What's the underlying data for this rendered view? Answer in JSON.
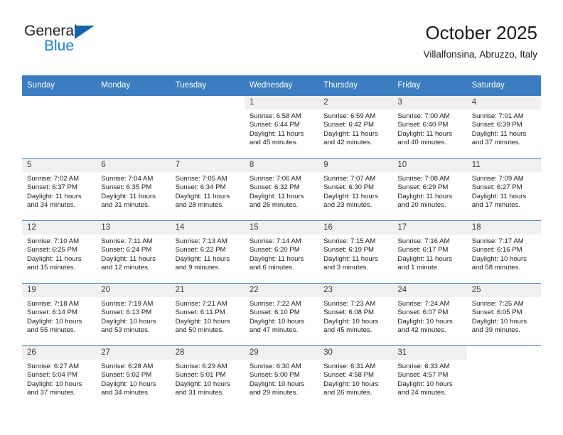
{
  "brand": {
    "name_top": "General",
    "name_bottom": "Blue",
    "accent_color": "#1880d4",
    "triangle_color": "#1464aa",
    "triangle_icon": "triangle-icon"
  },
  "header": {
    "title": "October 2025",
    "subtitle": "Villalfonsina, Abruzzo, Italy"
  },
  "theme": {
    "header_bar": "#3b7dc0",
    "daynum_bg": "#f0f0f0",
    "grid_line": "#3b7dc0",
    "text": "#1c1c1c"
  },
  "weekdays": [
    "Sunday",
    "Monday",
    "Tuesday",
    "Wednesday",
    "Thursday",
    "Friday",
    "Saturday"
  ],
  "weeks": [
    [
      {
        "day": "",
        "blank": true
      },
      {
        "day": "",
        "blank": true
      },
      {
        "day": "",
        "blank": true
      },
      {
        "day": "1",
        "sunrise": "Sunrise: 6:58 AM",
        "sunset": "Sunset: 6:44 PM",
        "daylight1": "Daylight: 11 hours",
        "daylight2": "and 45 minutes."
      },
      {
        "day": "2",
        "sunrise": "Sunrise: 6:59 AM",
        "sunset": "Sunset: 6:42 PM",
        "daylight1": "Daylight: 11 hours",
        "daylight2": "and 42 minutes."
      },
      {
        "day": "3",
        "sunrise": "Sunrise: 7:00 AM",
        "sunset": "Sunset: 6:40 PM",
        "daylight1": "Daylight: 11 hours",
        "daylight2": "and 40 minutes."
      },
      {
        "day": "4",
        "sunrise": "Sunrise: 7:01 AM",
        "sunset": "Sunset: 6:39 PM",
        "daylight1": "Daylight: 11 hours",
        "daylight2": "and 37 minutes."
      }
    ],
    [
      {
        "day": "5",
        "sunrise": "Sunrise: 7:02 AM",
        "sunset": "Sunset: 6:37 PM",
        "daylight1": "Daylight: 11 hours",
        "daylight2": "and 34 minutes."
      },
      {
        "day": "6",
        "sunrise": "Sunrise: 7:04 AM",
        "sunset": "Sunset: 6:35 PM",
        "daylight1": "Daylight: 11 hours",
        "daylight2": "and 31 minutes."
      },
      {
        "day": "7",
        "sunrise": "Sunrise: 7:05 AM",
        "sunset": "Sunset: 6:34 PM",
        "daylight1": "Daylight: 11 hours",
        "daylight2": "and 28 minutes."
      },
      {
        "day": "8",
        "sunrise": "Sunrise: 7:06 AM",
        "sunset": "Sunset: 6:32 PM",
        "daylight1": "Daylight: 11 hours",
        "daylight2": "and 26 minutes."
      },
      {
        "day": "9",
        "sunrise": "Sunrise: 7:07 AM",
        "sunset": "Sunset: 6:30 PM",
        "daylight1": "Daylight: 11 hours",
        "daylight2": "and 23 minutes."
      },
      {
        "day": "10",
        "sunrise": "Sunrise: 7:08 AM",
        "sunset": "Sunset: 6:29 PM",
        "daylight1": "Daylight: 11 hours",
        "daylight2": "and 20 minutes."
      },
      {
        "day": "11",
        "sunrise": "Sunrise: 7:09 AM",
        "sunset": "Sunset: 6:27 PM",
        "daylight1": "Daylight: 11 hours",
        "daylight2": "and 17 minutes."
      }
    ],
    [
      {
        "day": "12",
        "sunrise": "Sunrise: 7:10 AM",
        "sunset": "Sunset: 6:25 PM",
        "daylight1": "Daylight: 11 hours",
        "daylight2": "and 15 minutes."
      },
      {
        "day": "13",
        "sunrise": "Sunrise: 7:11 AM",
        "sunset": "Sunset: 6:24 PM",
        "daylight1": "Daylight: 11 hours",
        "daylight2": "and 12 minutes."
      },
      {
        "day": "14",
        "sunrise": "Sunrise: 7:13 AM",
        "sunset": "Sunset: 6:22 PM",
        "daylight1": "Daylight: 11 hours",
        "daylight2": "and 9 minutes."
      },
      {
        "day": "15",
        "sunrise": "Sunrise: 7:14 AM",
        "sunset": "Sunset: 6:20 PM",
        "daylight1": "Daylight: 11 hours",
        "daylight2": "and 6 minutes."
      },
      {
        "day": "16",
        "sunrise": "Sunrise: 7:15 AM",
        "sunset": "Sunset: 6:19 PM",
        "daylight1": "Daylight: 11 hours",
        "daylight2": "and 3 minutes."
      },
      {
        "day": "17",
        "sunrise": "Sunrise: 7:16 AM",
        "sunset": "Sunset: 6:17 PM",
        "daylight1": "Daylight: 11 hours",
        "daylight2": "and 1 minute."
      },
      {
        "day": "18",
        "sunrise": "Sunrise: 7:17 AM",
        "sunset": "Sunset: 6:16 PM",
        "daylight1": "Daylight: 10 hours",
        "daylight2": "and 58 minutes."
      }
    ],
    [
      {
        "day": "19",
        "sunrise": "Sunrise: 7:18 AM",
        "sunset": "Sunset: 6:14 PM",
        "daylight1": "Daylight: 10 hours",
        "daylight2": "and 55 minutes."
      },
      {
        "day": "20",
        "sunrise": "Sunrise: 7:19 AM",
        "sunset": "Sunset: 6:13 PM",
        "daylight1": "Daylight: 10 hours",
        "daylight2": "and 53 minutes."
      },
      {
        "day": "21",
        "sunrise": "Sunrise: 7:21 AM",
        "sunset": "Sunset: 6:11 PM",
        "daylight1": "Daylight: 10 hours",
        "daylight2": "and 50 minutes."
      },
      {
        "day": "22",
        "sunrise": "Sunrise: 7:22 AM",
        "sunset": "Sunset: 6:10 PM",
        "daylight1": "Daylight: 10 hours",
        "daylight2": "and 47 minutes."
      },
      {
        "day": "23",
        "sunrise": "Sunrise: 7:23 AM",
        "sunset": "Sunset: 6:08 PM",
        "daylight1": "Daylight: 10 hours",
        "daylight2": "and 45 minutes."
      },
      {
        "day": "24",
        "sunrise": "Sunrise: 7:24 AM",
        "sunset": "Sunset: 6:07 PM",
        "daylight1": "Daylight: 10 hours",
        "daylight2": "and 42 minutes."
      },
      {
        "day": "25",
        "sunrise": "Sunrise: 7:25 AM",
        "sunset": "Sunset: 6:05 PM",
        "daylight1": "Daylight: 10 hours",
        "daylight2": "and 39 minutes."
      }
    ],
    [
      {
        "day": "26",
        "sunrise": "Sunrise: 6:27 AM",
        "sunset": "Sunset: 5:04 PM",
        "daylight1": "Daylight: 10 hours",
        "daylight2": "and 37 minutes."
      },
      {
        "day": "27",
        "sunrise": "Sunrise: 6:28 AM",
        "sunset": "Sunset: 5:02 PM",
        "daylight1": "Daylight: 10 hours",
        "daylight2": "and 34 minutes."
      },
      {
        "day": "28",
        "sunrise": "Sunrise: 6:29 AM",
        "sunset": "Sunset: 5:01 PM",
        "daylight1": "Daylight: 10 hours",
        "daylight2": "and 31 minutes."
      },
      {
        "day": "29",
        "sunrise": "Sunrise: 6:30 AM",
        "sunset": "Sunset: 5:00 PM",
        "daylight1": "Daylight: 10 hours",
        "daylight2": "and 29 minutes."
      },
      {
        "day": "30",
        "sunrise": "Sunrise: 6:31 AM",
        "sunset": "Sunset: 4:58 PM",
        "daylight1": "Daylight: 10 hours",
        "daylight2": "and 26 minutes."
      },
      {
        "day": "31",
        "sunrise": "Sunrise: 6:33 AM",
        "sunset": "Sunset: 4:57 PM",
        "daylight1": "Daylight: 10 hours",
        "daylight2": "and 24 minutes."
      },
      {
        "day": "",
        "blank": true
      }
    ]
  ]
}
